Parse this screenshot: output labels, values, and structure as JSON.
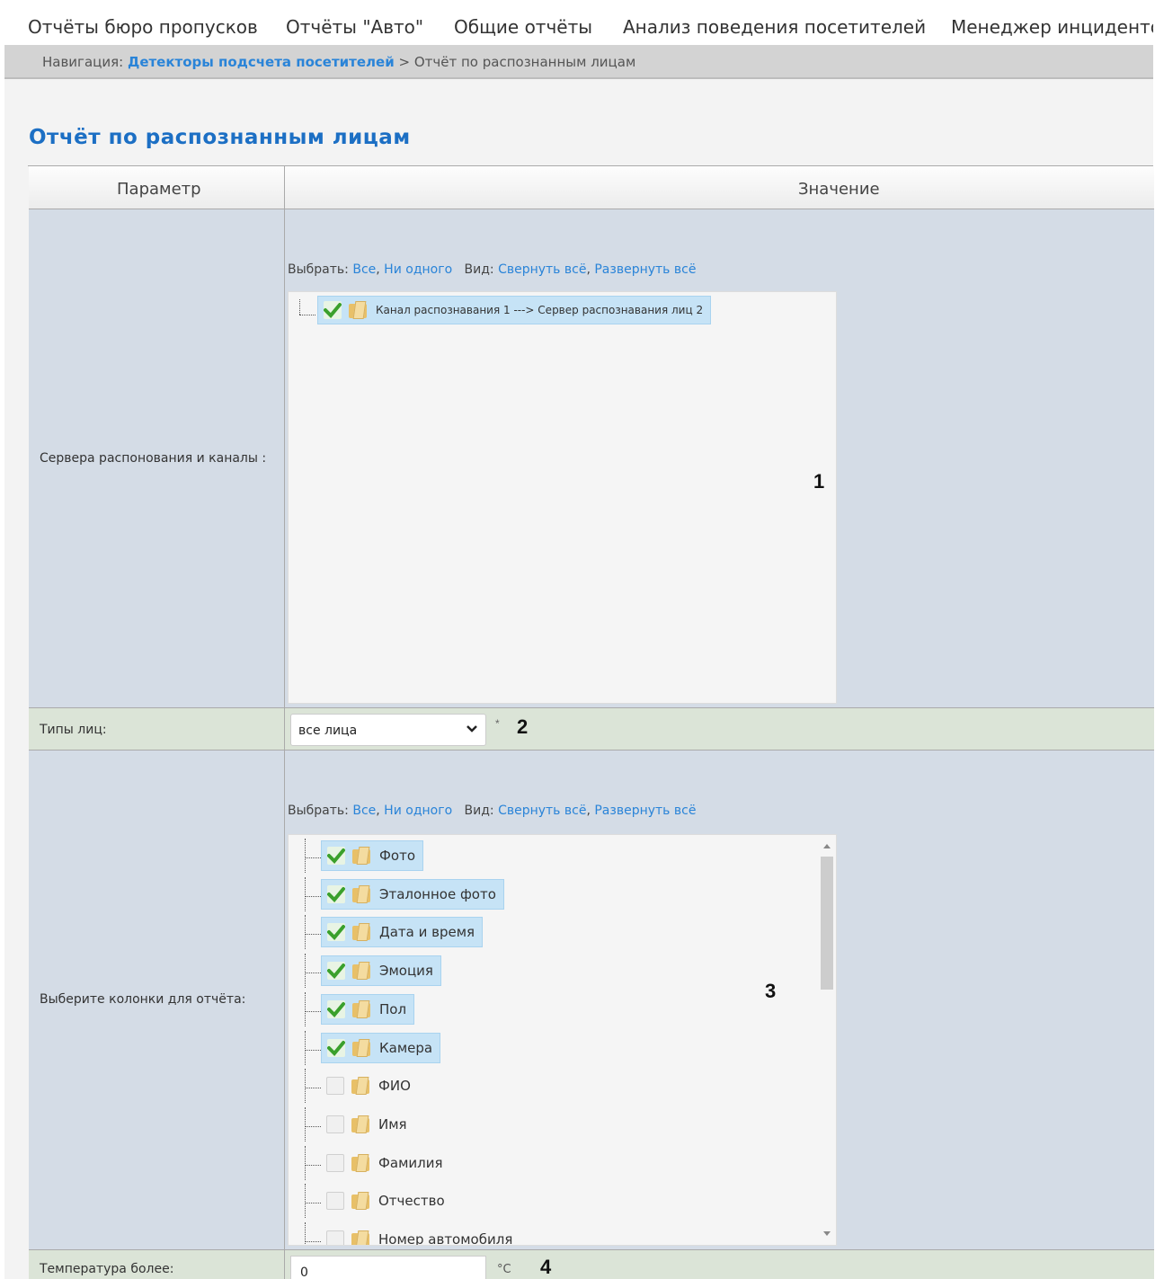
{
  "top_menu": [
    "Отчёты бюро пропусков",
    "Отчёты \"Авто\"",
    "Общие отчёты",
    "Анализ поведения посетителей",
    "Менеджер инцидентов"
  ],
  "breadcrumb": {
    "prefix": "Навигация:",
    "link": "Детекторы подсчета посетителей",
    "separator": ">",
    "current": "Отчёт по распознанным лицам"
  },
  "page_title": "Отчёт по распознанным лицам",
  "table": {
    "col_param": "Параметр",
    "col_value": "Значение"
  },
  "select_bar": {
    "select_label": "Выбрать:",
    "all": "Все",
    "comma": ",",
    "none": "Ни одного",
    "view_label": "Вид:",
    "collapse": "Свернуть всё",
    "expand": "Развернуть всё"
  },
  "servers": {
    "label": "Сервера распонования и каналы :",
    "marker": "1",
    "items": [
      {
        "label": "Канал распознавания 1 ---> Сервер распознавания лиц 2",
        "checked": true
      }
    ]
  },
  "face_types": {
    "label": "Типы лиц:",
    "value": "все лица",
    "required": "*",
    "marker": "2"
  },
  "columns": {
    "label": "Выберите колонки для отчёта:",
    "marker": "3",
    "items": [
      {
        "label": "Фото",
        "checked": true
      },
      {
        "label": "Эталонное фото",
        "checked": true
      },
      {
        "label": "Дата и время",
        "checked": true
      },
      {
        "label": "Эмоция",
        "checked": true
      },
      {
        "label": "Пол",
        "checked": true
      },
      {
        "label": "Камера",
        "checked": true
      },
      {
        "label": "ФИО",
        "checked": false
      },
      {
        "label": "Имя",
        "checked": false
      },
      {
        "label": "Фамилия",
        "checked": false
      },
      {
        "label": "Отчество",
        "checked": false
      },
      {
        "label": "Номер автомобиля",
        "checked": false
      }
    ]
  },
  "temperature": {
    "label": "Температура более:",
    "value": "0",
    "unit": "°C",
    "marker": "4"
  },
  "colors": {
    "link": "#2a84d8",
    "title": "#1c6fc4",
    "row_blue": "#d4dce6",
    "row_green": "#dbe4d7",
    "check_green": "#3aa02c"
  }
}
